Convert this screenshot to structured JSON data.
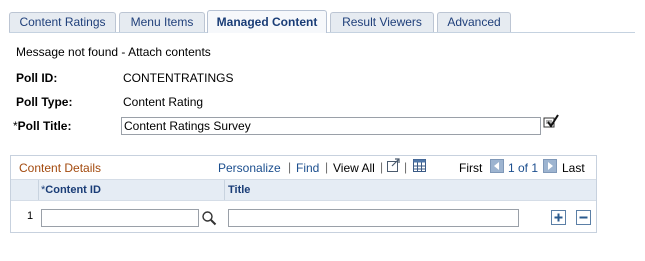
{
  "tabs": [
    "Content Ratings",
    "Menu Items",
    "Managed Content",
    "Result Viewers",
    "Advanced"
  ],
  "message": "Message not found - Attach contents",
  "fields": {
    "poll_id_label": "Poll ID:",
    "poll_id_value": "CONTENTRATINGS",
    "poll_type_label": "Poll Type:",
    "poll_type_value": "Content Rating",
    "poll_title_required": "*",
    "poll_title_label": "Poll Title:",
    "poll_title_value": "Content Ratings Survey"
  },
  "grid": {
    "title": "Content Details",
    "personalize": "Personalize",
    "sep": "|",
    "find": "Find",
    "view_all": "View All",
    "first": "First",
    "range": "1 of 1",
    "last": "Last",
    "col_content_id_required": "*",
    "col_content_id": "Content ID",
    "col_title": "Title",
    "rows": [
      {
        "num": "1",
        "content_id": "",
        "title": ""
      }
    ]
  },
  "icons": {
    "spell_check": "spell-check-icon",
    "download": "download-grid-icon",
    "spreadsheet": "spreadsheet-icon",
    "lookup": "lookup-icon",
    "prev": "previous-arrow-icon",
    "next": "next-arrow-icon",
    "add_row": "add-row-icon",
    "delete_row": "delete-row-icon"
  },
  "colors": {
    "tab_text": "#1f3f7a",
    "grid_title": "#a34a0e",
    "link": "#1b4e8e",
    "grid_header_bg": "#e5ecf4"
  }
}
